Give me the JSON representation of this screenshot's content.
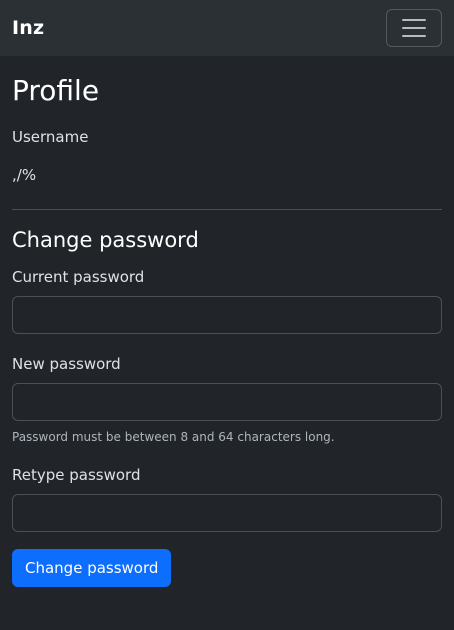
{
  "navbar": {
    "brand": "Inz",
    "toggler_icon": "hamburger-menu-icon"
  },
  "profile": {
    "title": "Profile",
    "username_label": "Username",
    "username_value": ",/%"
  },
  "change_password": {
    "title": "Change password",
    "current_label": "Current password",
    "current_value": "",
    "new_label": "New password",
    "new_value": "",
    "new_help": "Password must be between 8 and 64 characters long.",
    "retype_label": "Retype password",
    "retype_value": "",
    "submit_label": "Change password"
  },
  "colors": {
    "background": "#212529",
    "navbar": "#2b3035",
    "primary": "#0d6efd"
  }
}
